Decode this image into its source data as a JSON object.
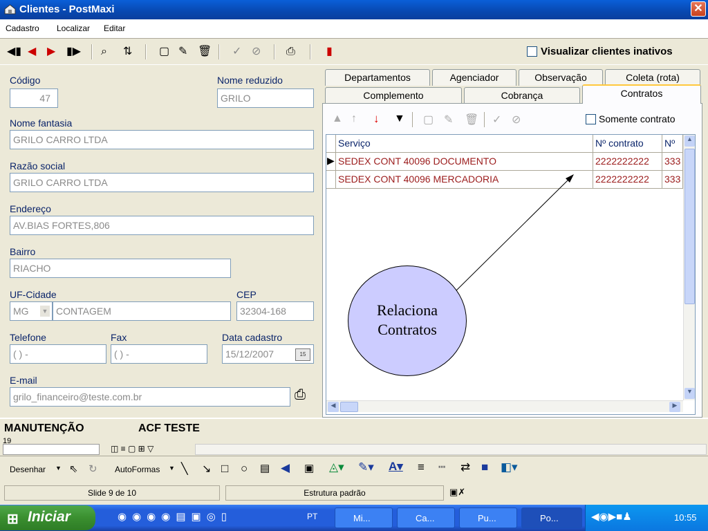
{
  "window": {
    "title": "Clientes - PostMaxi"
  },
  "menu": [
    "Cadastro",
    "Localizar",
    "Editar"
  ],
  "toolbar": {
    "inativos_label": "Visualizar clientes inativos"
  },
  "form": {
    "codigo": {
      "label": "Código",
      "value": "47"
    },
    "nome_reduzido": {
      "label": "Nome reduzido",
      "value": "GRILO"
    },
    "nome_fantasia": {
      "label": "Nome fantasia",
      "value": "GRILO CARRO LTDA"
    },
    "razao_social": {
      "label": "Razão social",
      "value": "GRILO CARRO LTDA"
    },
    "endereco": {
      "label": "Endereço",
      "value": "AV.BIAS FORTES,806"
    },
    "bairro": {
      "label": "Bairro",
      "value": "RIACHO"
    },
    "uf_cidade": {
      "label": "UF-Cidade",
      "uf": "MG",
      "cidade": "CONTAGEM"
    },
    "cep": {
      "label": "CEP",
      "value": "32304-168"
    },
    "telefone": {
      "label": "Telefone",
      "value": "(  )    -"
    },
    "fax": {
      "label": "Fax",
      "value": "(  )    -"
    },
    "data_cadastro": {
      "label": "Data cadastro",
      "value": "15/12/2007",
      "cal": "15"
    },
    "email": {
      "label": "E-mail",
      "value": "grilo_financeiro@teste.com.br"
    }
  },
  "tabs": {
    "row1": [
      "Departamentos",
      "Agenciador",
      "Observação",
      "Coleta (rota)"
    ],
    "row2": [
      "Complemento",
      "Cobrança",
      "Contratos"
    ],
    "active": "Contratos"
  },
  "contratos": {
    "somente_label": "Somente contrato",
    "columns": [
      "Serviço",
      "Nº contrato",
      "Nº"
    ],
    "rows": [
      [
        "SEDEX CONT 40096 DOCUMENTO",
        "2222222222",
        "333"
      ],
      [
        "SEDEX CONT 40096 MERCADORIA",
        "2222222222",
        "333"
      ]
    ]
  },
  "callout": {
    "line1": "Relaciona",
    "line2": "Contratos"
  },
  "status": {
    "left": "MANUTENÇÃO",
    "right": "ACF TESTE"
  },
  "ppt": {
    "draw_label": "Desenhar",
    "autoshapes_label": "AutoFormas",
    "slide_info": "Slide 9 de 10",
    "design": "Estrutura padrão",
    "zoom_fragment": "19"
  },
  "taskbar": {
    "start_label": "Iniciar",
    "lang": "PT",
    "items": [
      "Mi...",
      "Ca...",
      "Pu...",
      "Po..."
    ],
    "clock": "10:55"
  }
}
